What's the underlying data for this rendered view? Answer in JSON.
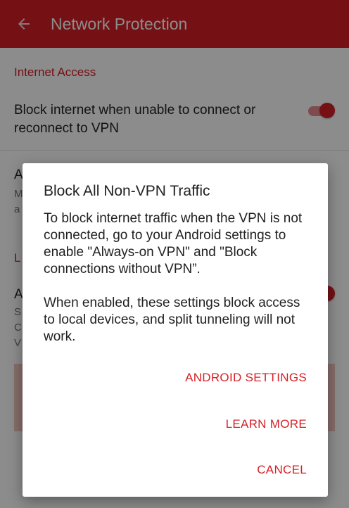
{
  "appbar": {
    "title": "Network Protection",
    "back_icon": "arrow-left-icon",
    "color": "#d62027"
  },
  "settings": {
    "section1_header": "Internet Access",
    "block_internet": {
      "title": "Block internet when unable to connect or reconnect to VPN",
      "enabled": true
    },
    "pref2": {
      "title_visible": "A",
      "summary_visible_lines": [
        "M",
        "a"
      ]
    },
    "section2_header_visible": "L",
    "pref3": {
      "title_visible": "A",
      "summary_visible_lines": [
        "S",
        "C",
        "V"
      ],
      "enabled": true
    }
  },
  "dialog": {
    "title": "Block All Non-VPN Traffic",
    "paragraphs": [
      "To block internet traffic when the VPN is not connected, go to your Android settings to enable \"Always-on VPN\" and \"Block connections without VPN”.",
      "When enabled, these settings block access to local devices, and split tunneling will not work."
    ],
    "buttons": {
      "android_settings": "ANDROID SETTINGS",
      "learn_more": "LEARN MORE",
      "cancel": "CANCEL"
    }
  }
}
